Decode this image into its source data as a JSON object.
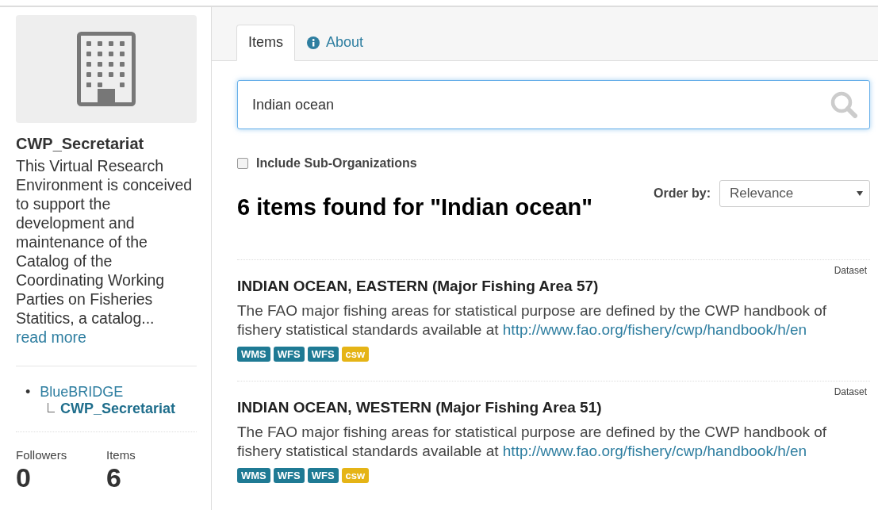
{
  "organization": {
    "name": "CWP_Secretariat",
    "description": "This Virtual Research Environment is conceived to support the development and maintenance of the Catalog of the Coordinating Working Parties on Fisheries Statitics, a catalog...",
    "read_more": "read more"
  },
  "hierarchy": {
    "bullet": "•",
    "parent": "BlueBRIDGE",
    "child": "CWP_Secretariat"
  },
  "stats": [
    {
      "label": "Followers",
      "value": "0"
    },
    {
      "label": "Items",
      "value": "6"
    }
  ],
  "tabs": [
    {
      "label": "Items",
      "selected": true,
      "kind": "plain"
    },
    {
      "label": "About",
      "selected": false,
      "kind": "info"
    }
  ],
  "search": {
    "value": "Indian ocean"
  },
  "include_sub_organizations": {
    "label": "Include Sub-Organizations",
    "checked": false
  },
  "result_heading": "6 items found for \"Indian ocean\"",
  "order_by": {
    "label": "Order by:",
    "value": "Relevance"
  },
  "results": [
    {
      "type": "Dataset",
      "title": "INDIAN OCEAN, EASTERN (Major Fishing Area 57)",
      "text": "The FAO major fishing areas for statistical purpose are defined by the CWP handbook of fishery statistical standards available at",
      "link": "http://www.fao.org/fishery/cwp/handbook/h/en",
      "tags": [
        {
          "label": "WMS",
          "color": "#1f7a94"
        },
        {
          "label": "WFS",
          "color": "#1f7a94"
        },
        {
          "label": "WFS",
          "color": "#1f7a94"
        },
        {
          "label": "csw",
          "color": "#e5b416"
        }
      ]
    },
    {
      "type": "Dataset",
      "title": "INDIAN OCEAN, WESTERN (Major Fishing Area 51)",
      "text": "The FAO major fishing areas for statistical purpose are defined by the CWP handbook of fishery statistical standards available at",
      "link": "http://www.fao.org/fishery/cwp/handbook/h/en",
      "tags": [
        {
          "label": "WMS",
          "color": "#1f7a94"
        },
        {
          "label": "WFS",
          "color": "#1f7a94"
        },
        {
          "label": "WFS",
          "color": "#1f7a94"
        },
        {
          "label": "csw",
          "color": "#e5b416"
        }
      ]
    }
  ]
}
